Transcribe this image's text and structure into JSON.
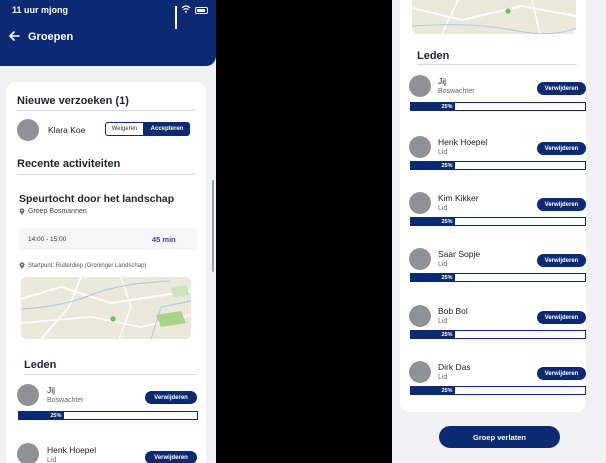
{
  "status_bar": {
    "time": "11 uur mjong"
  },
  "header": {
    "title": "Groepen"
  },
  "requests": {
    "title": "Nieuwe verzoeken (1)",
    "items": [
      {
        "name": "Klara Koe",
        "decline_label": "Weigeren",
        "accept_label": "Accepteren"
      }
    ]
  },
  "recent": {
    "title": "Recente activiteiten",
    "activity": {
      "title": "Speurtocht door het landschap",
      "group": "Groep Bosmannen",
      "time_range": "14:00 - 15:00",
      "duration": "45 min",
      "start_point": "Startpunt: Ruiterdiep (Groninger Landschap)"
    }
  },
  "members": {
    "title": "Leden",
    "remove_label": "Verwijderen",
    "items": [
      {
        "name": "Jij",
        "role": "Boswachter",
        "progress": 25,
        "progress_label": "25%"
      },
      {
        "name": "Henk Hoepel",
        "role": "Lid",
        "progress": 25,
        "progress_label": "25%"
      },
      {
        "name": "Kim Kikker",
        "role": "Lid",
        "progress": 25,
        "progress_label": "25%"
      },
      {
        "name": "Saar Sopje",
        "role": "Lid",
        "progress": 25,
        "progress_label": "25%"
      },
      {
        "name": "Bob Bol",
        "role": "Lid",
        "progress": 25,
        "progress_label": "25%"
      },
      {
        "name": "Dirk Das",
        "role": "Lid",
        "progress": 25,
        "progress_label": "25%"
      }
    ]
  },
  "footer": {
    "leave_label": "Groep verlaten"
  },
  "colors": {
    "primary": "#0c2a74",
    "accent_text": "#2b49b8",
    "background": "#f1f1f4",
    "avatar": "#8f9196"
  }
}
